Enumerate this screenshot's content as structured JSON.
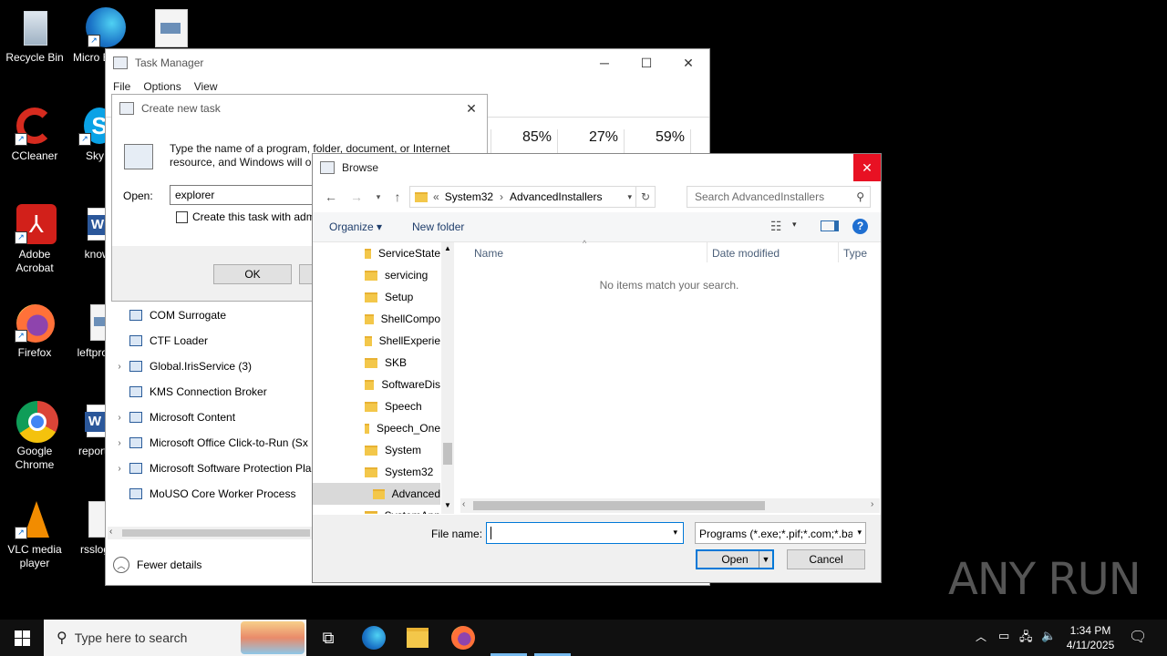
{
  "desktop": {
    "icons": [
      {
        "label": "Recycle Bin"
      },
      {
        "label": "Micro Edg"
      },
      {
        "label": "CCleaner"
      },
      {
        "label": "Sky"
      },
      {
        "label": "Adobe Acrobat"
      },
      {
        "label": "knowle"
      },
      {
        "label": "Firefox"
      },
      {
        "label": "leftproc"
      },
      {
        "label": "Google Chrome"
      },
      {
        "label": "reporte"
      },
      {
        "label": "VLC media player"
      },
      {
        "label": "rsslog"
      }
    ]
  },
  "taskmanager": {
    "title": "Task Manager",
    "menu": [
      "File",
      "Options",
      "View"
    ],
    "stats": [
      "85%",
      "27%",
      "59%"
    ],
    "processes": [
      {
        "name": "COM Surrogate",
        "expandable": false
      },
      {
        "name": "COM Surrogate",
        "expandable": false
      },
      {
        "name": "CTF Loader",
        "expandable": false
      },
      {
        "name": "Global.IrisService (3)",
        "expandable": true
      },
      {
        "name": "KMS Connection Broker",
        "expandable": false
      },
      {
        "name": "Microsoft Content",
        "expandable": true
      },
      {
        "name": "Microsoft Office Click-to-Run (Sx",
        "expandable": true
      },
      {
        "name": "Microsoft Software Protection Pla",
        "expandable": true
      },
      {
        "name": "MoUSO Core Worker Process",
        "expandable": false
      }
    ],
    "fewer_details": "Fewer details"
  },
  "create_task": {
    "title": "Create new task",
    "description": "Type the name of a program, folder, document, or Internet resource, and Windows will op",
    "open_label": "Open:",
    "open_value": "explorer",
    "admin_checkbox": "Create this task with adm",
    "ok": "OK"
  },
  "browse": {
    "title": "Browse",
    "breadcrumb": [
      "«",
      "System32",
      "AdvancedInstallers"
    ],
    "search_placeholder": "Search AdvancedInstallers",
    "toolbar": {
      "organize": "Organize ▾",
      "new_folder": "New folder"
    },
    "tree": [
      "ServiceState",
      "servicing",
      "Setup",
      "ShellCompo",
      "ShellExperie",
      "SKB",
      "SoftwareDis",
      "Speech",
      "Speech_One",
      "System",
      "System32",
      "Advanced",
      "SystemApp"
    ],
    "tree_selected": "Advanced",
    "columns": [
      "Name",
      "Date modified",
      "Type"
    ],
    "empty_message": "No items match your search.",
    "filename_label": "File name:",
    "filename_value": "",
    "filetype": "Programs (*.exe;*.pif;*.com;*.ba",
    "open_button": "Open",
    "cancel_button": "Cancel"
  },
  "taskbar": {
    "search_placeholder": "Type here to search",
    "time": "1:34 PM",
    "date": "4/11/2025"
  },
  "watermark": "ANY RUN"
}
